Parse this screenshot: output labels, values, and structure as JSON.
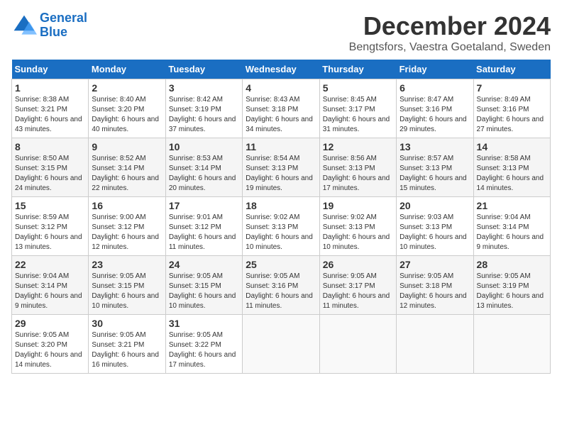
{
  "logo": {
    "line1": "General",
    "line2": "Blue"
  },
  "title": "December 2024",
  "subtitle": "Bengtsfors, Vaestra Goetaland, Sweden",
  "days_header": [
    "Sunday",
    "Monday",
    "Tuesday",
    "Wednesday",
    "Thursday",
    "Friday",
    "Saturday"
  ],
  "weeks": [
    [
      {
        "day": "1",
        "sunrise": "Sunrise: 8:38 AM",
        "sunset": "Sunset: 3:21 PM",
        "daylight": "Daylight: 6 hours and 43 minutes."
      },
      {
        "day": "2",
        "sunrise": "Sunrise: 8:40 AM",
        "sunset": "Sunset: 3:20 PM",
        "daylight": "Daylight: 6 hours and 40 minutes."
      },
      {
        "day": "3",
        "sunrise": "Sunrise: 8:42 AM",
        "sunset": "Sunset: 3:19 PM",
        "daylight": "Daylight: 6 hours and 37 minutes."
      },
      {
        "day": "4",
        "sunrise": "Sunrise: 8:43 AM",
        "sunset": "Sunset: 3:18 PM",
        "daylight": "Daylight: 6 hours and 34 minutes."
      },
      {
        "day": "5",
        "sunrise": "Sunrise: 8:45 AM",
        "sunset": "Sunset: 3:17 PM",
        "daylight": "Daylight: 6 hours and 31 minutes."
      },
      {
        "day": "6",
        "sunrise": "Sunrise: 8:47 AM",
        "sunset": "Sunset: 3:16 PM",
        "daylight": "Daylight: 6 hours and 29 minutes."
      },
      {
        "day": "7",
        "sunrise": "Sunrise: 8:49 AM",
        "sunset": "Sunset: 3:16 PM",
        "daylight": "Daylight: 6 hours and 27 minutes."
      }
    ],
    [
      {
        "day": "8",
        "sunrise": "Sunrise: 8:50 AM",
        "sunset": "Sunset: 3:15 PM",
        "daylight": "Daylight: 6 hours and 24 minutes."
      },
      {
        "day": "9",
        "sunrise": "Sunrise: 8:52 AM",
        "sunset": "Sunset: 3:14 PM",
        "daylight": "Daylight: 6 hours and 22 minutes."
      },
      {
        "day": "10",
        "sunrise": "Sunrise: 8:53 AM",
        "sunset": "Sunset: 3:14 PM",
        "daylight": "Daylight: 6 hours and 20 minutes."
      },
      {
        "day": "11",
        "sunrise": "Sunrise: 8:54 AM",
        "sunset": "Sunset: 3:13 PM",
        "daylight": "Daylight: 6 hours and 19 minutes."
      },
      {
        "day": "12",
        "sunrise": "Sunrise: 8:56 AM",
        "sunset": "Sunset: 3:13 PM",
        "daylight": "Daylight: 6 hours and 17 minutes."
      },
      {
        "day": "13",
        "sunrise": "Sunrise: 8:57 AM",
        "sunset": "Sunset: 3:13 PM",
        "daylight": "Daylight: 6 hours and 15 minutes."
      },
      {
        "day": "14",
        "sunrise": "Sunrise: 8:58 AM",
        "sunset": "Sunset: 3:13 PM",
        "daylight": "Daylight: 6 hours and 14 minutes."
      }
    ],
    [
      {
        "day": "15",
        "sunrise": "Sunrise: 8:59 AM",
        "sunset": "Sunset: 3:12 PM",
        "daylight": "Daylight: 6 hours and 13 minutes."
      },
      {
        "day": "16",
        "sunrise": "Sunrise: 9:00 AM",
        "sunset": "Sunset: 3:12 PM",
        "daylight": "Daylight: 6 hours and 12 minutes."
      },
      {
        "day": "17",
        "sunrise": "Sunrise: 9:01 AM",
        "sunset": "Sunset: 3:12 PM",
        "daylight": "Daylight: 6 hours and 11 minutes."
      },
      {
        "day": "18",
        "sunrise": "Sunrise: 9:02 AM",
        "sunset": "Sunset: 3:13 PM",
        "daylight": "Daylight: 6 hours and 10 minutes."
      },
      {
        "day": "19",
        "sunrise": "Sunrise: 9:02 AM",
        "sunset": "Sunset: 3:13 PM",
        "daylight": "Daylight: 6 hours and 10 minutes."
      },
      {
        "day": "20",
        "sunrise": "Sunrise: 9:03 AM",
        "sunset": "Sunset: 3:13 PM",
        "daylight": "Daylight: 6 hours and 10 minutes."
      },
      {
        "day": "21",
        "sunrise": "Sunrise: 9:04 AM",
        "sunset": "Sunset: 3:14 PM",
        "daylight": "Daylight: 6 hours and 9 minutes."
      }
    ],
    [
      {
        "day": "22",
        "sunrise": "Sunrise: 9:04 AM",
        "sunset": "Sunset: 3:14 PM",
        "daylight": "Daylight: 6 hours and 9 minutes."
      },
      {
        "day": "23",
        "sunrise": "Sunrise: 9:05 AM",
        "sunset": "Sunset: 3:15 PM",
        "daylight": "Daylight: 6 hours and 10 minutes."
      },
      {
        "day": "24",
        "sunrise": "Sunrise: 9:05 AM",
        "sunset": "Sunset: 3:15 PM",
        "daylight": "Daylight: 6 hours and 10 minutes."
      },
      {
        "day": "25",
        "sunrise": "Sunrise: 9:05 AM",
        "sunset": "Sunset: 3:16 PM",
        "daylight": "Daylight: 6 hours and 11 minutes."
      },
      {
        "day": "26",
        "sunrise": "Sunrise: 9:05 AM",
        "sunset": "Sunset: 3:17 PM",
        "daylight": "Daylight: 6 hours and 11 minutes."
      },
      {
        "day": "27",
        "sunrise": "Sunrise: 9:05 AM",
        "sunset": "Sunset: 3:18 PM",
        "daylight": "Daylight: 6 hours and 12 minutes."
      },
      {
        "day": "28",
        "sunrise": "Sunrise: 9:05 AM",
        "sunset": "Sunset: 3:19 PM",
        "daylight": "Daylight: 6 hours and 13 minutes."
      }
    ],
    [
      {
        "day": "29",
        "sunrise": "Sunrise: 9:05 AM",
        "sunset": "Sunset: 3:20 PM",
        "daylight": "Daylight: 6 hours and 14 minutes."
      },
      {
        "day": "30",
        "sunrise": "Sunrise: 9:05 AM",
        "sunset": "Sunset: 3:21 PM",
        "daylight": "Daylight: 6 hours and 16 minutes."
      },
      {
        "day": "31",
        "sunrise": "Sunrise: 9:05 AM",
        "sunset": "Sunset: 3:22 PM",
        "daylight": "Daylight: 6 hours and 17 minutes."
      },
      null,
      null,
      null,
      null
    ]
  ]
}
